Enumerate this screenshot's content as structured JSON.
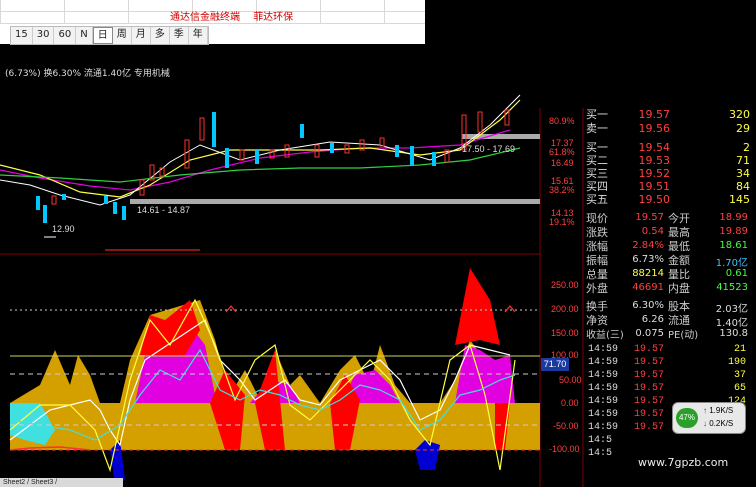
{
  "banner": {
    "line1": "通达信金融终端",
    "line2": "菲达环保"
  },
  "timeframes": [
    "15",
    "30",
    "60",
    "N",
    "日",
    "周",
    "月",
    "多",
    "季",
    "年"
  ],
  "active_timeframe": "日",
  "info": {
    "text": "(6.73%) 换6.30% 流通1.40亿 专用机械"
  },
  "price_annotations": {
    "band_upper": "17.50 - 17.69",
    "band_lower": "14.61 - 14.87",
    "low_mark": "12.90"
  },
  "price_axis": [
    "80.9%",
    "17.37",
    "61.8%",
    "16.49",
    "15.61",
    "38.2%",
    "14.13",
    "19.1%"
  ],
  "osc_axis": [
    "250.00",
    "200.00",
    "150.00",
    "100.00",
    "50.00",
    "0.00",
    "-50.00",
    "-100.00"
  ],
  "osc_current_value": "71.70",
  "order_book": [
    {
      "label": "买一",
      "price": "19.57",
      "vol": "320"
    },
    {
      "label": "卖一",
      "price": "19.56",
      "vol": "29"
    },
    {
      "label": "买一",
      "price": "19.54",
      "vol": "2"
    },
    {
      "label": "买二",
      "price": "19.53",
      "vol": "71"
    },
    {
      "label": "买三",
      "price": "19.52",
      "vol": "34"
    },
    {
      "label": "买四",
      "price": "19.51",
      "vol": "84"
    },
    {
      "label": "买五",
      "price": "19.50",
      "vol": "145"
    }
  ],
  "stats": [
    {
      "l1": "现价",
      "v1": "19.57",
      "l2": "今开",
      "v2": "18.99"
    },
    {
      "l1": "涨跌",
      "v1": "0.54",
      "l2": "最高",
      "v2": "19.89"
    },
    {
      "l1": "涨幅",
      "v1": "2.84%",
      "l2": "最低",
      "v2": "18.61"
    },
    {
      "l1": "振幅",
      "v1": "6.73%",
      "l2": "金额",
      "v2": "1.70亿"
    },
    {
      "l1": "总量",
      "v1": "88214",
      "l2": "量比",
      "v2": "0.61"
    },
    {
      "l1": "外盘",
      "v1": "46691",
      "l2": "内盘",
      "v2": "41523"
    }
  ],
  "stats2": [
    {
      "l1": "换手",
      "v1": "6.30%",
      "l2": "股本",
      "v2": "2.03亿"
    },
    {
      "l1": "净资",
      "v1": "6.26",
      "l2": "流通",
      "v2": "1.40亿"
    },
    {
      "l1": "收益(三)",
      "v1": "0.075",
      "l2": "PE(动)",
      "v2": "130.8"
    }
  ],
  "ticks": [
    {
      "t": "14:59",
      "p": "19.57",
      "v": "21",
      "s": "S"
    },
    {
      "t": "14:59",
      "p": "19.57",
      "v": "190",
      "s": "S"
    },
    {
      "t": "14:59",
      "p": "19.57",
      "v": "37",
      "s": "S"
    },
    {
      "t": "14:59",
      "p": "19.57",
      "v": "65",
      "s": "S"
    },
    {
      "t": "14:59",
      "p": "19.57",
      "v": "124",
      "s": "B"
    },
    {
      "t": "14:59",
      "p": "19.57",
      "v": "",
      "s": ""
    },
    {
      "t": "14:59",
      "p": "19.57",
      "v": "",
      "s": ""
    },
    {
      "t": "14:5",
      "p": "",
      "v": "",
      "s": ""
    },
    {
      "t": "14:5",
      "p": "",
      "v": "",
      "s": ""
    }
  ],
  "tray": {
    "pct": "47%",
    "up": "1.9K/S",
    "down": "0.2K/S"
  },
  "watermark": "www.7gpzb.com",
  "sheet_tabs": "Sheet2 / Sheet3 /",
  "colors": {
    "up": "#ff3030",
    "down": "#00c8ff",
    "magenta": "#e000e0",
    "gold": "#d4a000",
    "cyan": "#40e0e0"
  }
}
